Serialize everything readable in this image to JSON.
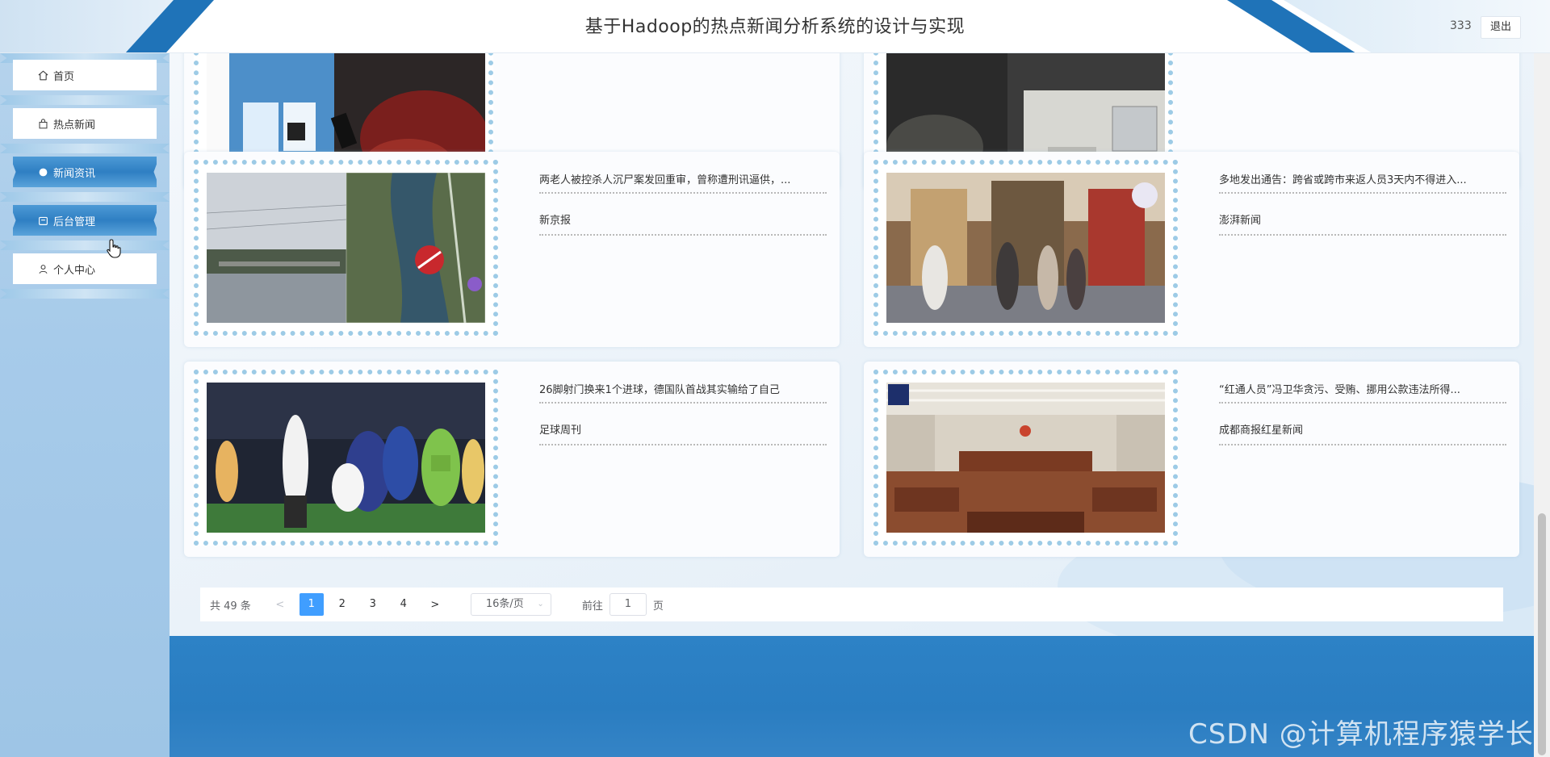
{
  "header": {
    "title": "基于Hadoop的热点新闻分析系统的设计与实现",
    "username": "333",
    "logout_label": "退出"
  },
  "sidebar": {
    "items": [
      {
        "label": "首页",
        "icon": "home-icon",
        "active": false
      },
      {
        "label": "热点新闻",
        "icon": "bag-icon",
        "active": false
      },
      {
        "label": "新闻资讯",
        "icon": "circle-icon",
        "active": true
      },
      {
        "label": "后台管理",
        "icon": "briefcase-icon",
        "active": true
      },
      {
        "label": "个人中心",
        "icon": "user-icon",
        "active": false
      }
    ]
  },
  "news": {
    "partial_top": [
      {
        "image": "news-photo-qr-scan"
      },
      {
        "image": "news-photo-office-laptop"
      }
    ],
    "items": [
      {
        "title": "两老人被控杀人沉尸案发回重审，曾称遭刑讯逼供，...",
        "source": "新京报",
        "image": "news-photo-river-map"
      },
      {
        "title": "多地发出通告：跨省或跨市来返人员3天内不得进入...",
        "source": "澎湃新闻",
        "image": "news-photo-mall-crowd"
      },
      {
        "title": "26脚射门换来1个进球，德国队首战其实输给了自己",
        "source": "足球周刊",
        "image": "news-photo-football-celebration"
      },
      {
        "title": "“红通人员”冯卫华贪污、受贿、挪用公款违法所得...",
        "source": "成都商报红星新闻",
        "image": "news-photo-courtroom"
      }
    ]
  },
  "pagination": {
    "total_label": "共 49 条",
    "prev": "<",
    "pages": [
      "1",
      "2",
      "3",
      "4"
    ],
    "current_page": "1",
    "next": ">",
    "page_size_label": "16条/页",
    "goto_label": "前往",
    "goto_value": "1",
    "page_suffix": "页"
  },
  "watermark": "CSDN @计算机程序猿学长",
  "colors": {
    "accent": "#409eff",
    "header_stripe": "#1f73b8",
    "footer": "#2d82c6",
    "sidebar_bg": "#a7cbea",
    "frame_dots": "#9dcbe6"
  }
}
